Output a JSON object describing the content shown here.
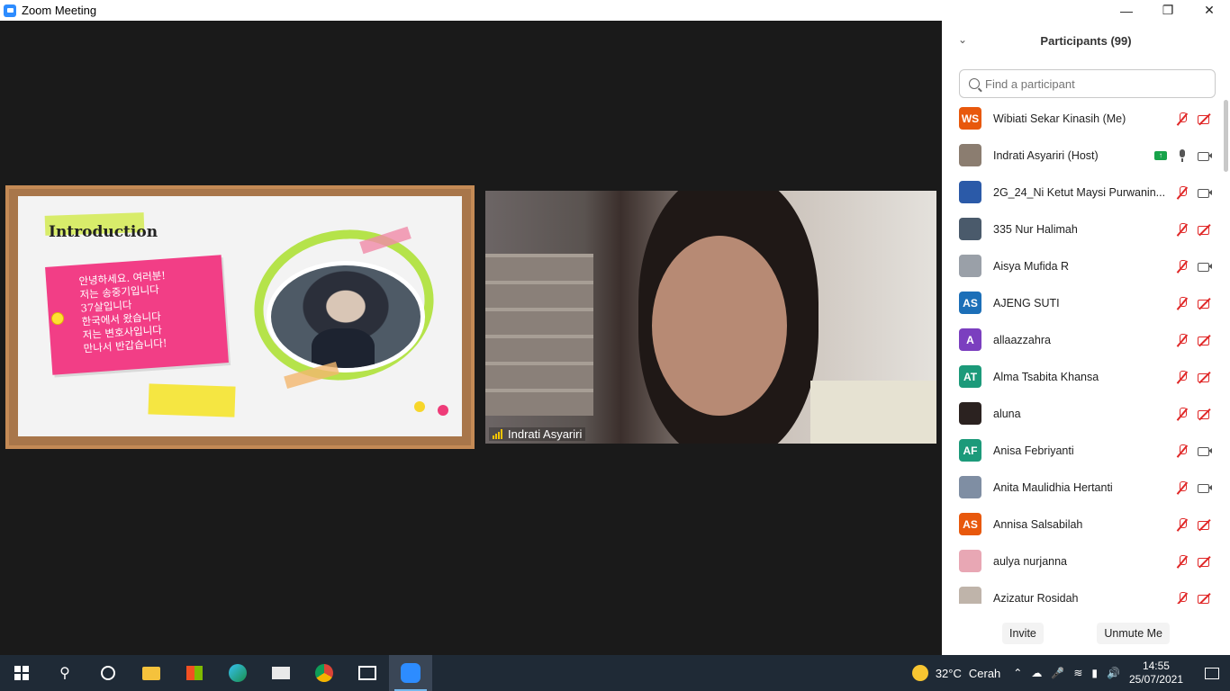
{
  "window": {
    "title": "Zoom Meeting"
  },
  "slide": {
    "title": "Introduction",
    "lines": [
      "안녕하세요. 여러분!",
      "저는 송중기입니다",
      "37살입니다",
      "한국에서 왔습니다",
      "저는 변호사입니다",
      "만나서 반갑습니다!"
    ]
  },
  "video": {
    "name": "Indrati Asyariri"
  },
  "participants": {
    "title": "Participants (99)",
    "search_placeholder": "Find a participant",
    "items": [
      {
        "initials": "WS",
        "color": "#e8580c",
        "name": "Wibiati Sekar Kinasih (Me)",
        "mic": "muted",
        "cam": "muted",
        "share": false
      },
      {
        "initials": "",
        "color": "#8b7d70",
        "name": "Indrati Asyariri (Host)",
        "mic": "on",
        "cam": "on",
        "share": true
      },
      {
        "initials": "",
        "color": "#2b5aa8",
        "name": "2G_24_Ni Ketut Maysi Purwanin...",
        "mic": "muted",
        "cam": "on",
        "share": false
      },
      {
        "initials": "",
        "color": "#4a5a6b",
        "name": "335 Nur Halimah",
        "mic": "muted",
        "cam": "muted",
        "share": false
      },
      {
        "initials": "",
        "color": "#9aa0a8",
        "name": "Aisya Mufida R",
        "mic": "muted",
        "cam": "on",
        "share": false
      },
      {
        "initials": "AS",
        "color": "#1c6fb8",
        "name": "AJENG SUTI",
        "mic": "muted",
        "cam": "muted",
        "share": false
      },
      {
        "initials": "A",
        "color": "#7b3fbf",
        "name": "allaazzahra",
        "mic": "muted",
        "cam": "muted",
        "share": false
      },
      {
        "initials": "AT",
        "color": "#1c9a7a",
        "name": "Alma Tsabita Khansa",
        "mic": "muted",
        "cam": "muted",
        "share": false
      },
      {
        "initials": "",
        "color": "#2b2220",
        "name": "aluna",
        "mic": "muted",
        "cam": "muted",
        "share": false
      },
      {
        "initials": "AF",
        "color": "#1c9a7a",
        "name": "Anisa Febriyanti",
        "mic": "muted",
        "cam": "on",
        "share": false
      },
      {
        "initials": "",
        "color": "#7f8ea3",
        "name": "Anita Maulidhia Hertanti",
        "mic": "muted",
        "cam": "on",
        "share": false
      },
      {
        "initials": "AS",
        "color": "#e8580c",
        "name": "Annisa Salsabilah",
        "mic": "muted",
        "cam": "muted",
        "share": false
      },
      {
        "initials": "",
        "color": "#e8a7b4",
        "name": "aulya nurjanna",
        "mic": "muted",
        "cam": "muted",
        "share": false
      },
      {
        "initials": "",
        "color": "#bfb4aa",
        "name": "Azizatur Rosidah",
        "mic": "muted",
        "cam": "muted",
        "share": false
      }
    ],
    "invite_label": "Invite",
    "unmute_label": "Unmute Me"
  },
  "taskbar": {
    "weather": {
      "temp": "32°C",
      "desc": "Cerah"
    },
    "time": "14:55",
    "date": "25/07/2021"
  }
}
